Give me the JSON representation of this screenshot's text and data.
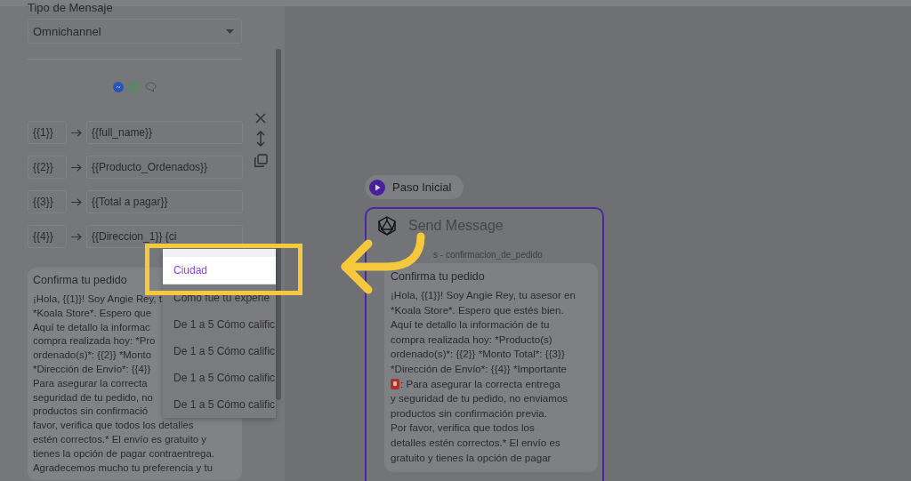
{
  "message_type": {
    "label": "Tipo de Mensaje",
    "value": "Omnichannel"
  },
  "variables": [
    {
      "key": "{{1}}",
      "value": "{{full_name}}"
    },
    {
      "key": "{{2}}",
      "value": "{{Producto_Ordenados}}"
    },
    {
      "key": "{{3}}",
      "value": "{{Total a pagar}}"
    },
    {
      "key": "{{4}}",
      "value": "{{Direccion_1}} {ci"
    }
  ],
  "preview": {
    "title": "Confirma tu pedido",
    "lines": [
      "¡Hola, {{1}}! Soy Angie Rey, t",
      "*Koala Store*. Espero que",
      "Aquí te detallo la informac",
      "compra realizada hoy: *Pro",
      "ordenado(s)*: {{2}} *Monto",
      "*Dirección de Envío*: {{4}}",
      "Para asegurar la correcta",
      "seguridad de tu pedido, no",
      "productos sin confirmació",
      "favor, verifica que todos los detalles",
      "estén correctos.* El envío es gratuito y",
      "tienes la opción de pagar contraentrega.",
      "Agradecemos mucho tu preferencia y tu"
    ]
  },
  "dropdown": {
    "items": [
      {
        "label": "Ciudad",
        "selected": true
      },
      {
        "label": "Cómo fue tu experie",
        "selected": false
      },
      {
        "label": "De 1 a 5 Cómo calific",
        "selected": false
      },
      {
        "label": "De 1 a 5 Cómo calific",
        "selected": false
      },
      {
        "label": "De 1 a 5 Cómo calific",
        "selected": false
      },
      {
        "label": "De 1 a 5 Cómo calific",
        "selected": false
      }
    ]
  },
  "start_node": {
    "label": "Paso Inicial"
  },
  "node": {
    "title": "Send Message",
    "subtitle": "s - confirmacion_de_pedido",
    "bubble": {
      "title": "Confirma tu pedido",
      "lines": [
        {
          "kind": "text",
          "text": "¡Hola, {{1}}! Soy Angie Rey, tu asesor en"
        },
        {
          "kind": "text",
          "text": "*Koala Store*. Espero que estés bien."
        },
        {
          "kind": "text",
          "text": "Aquí te detallo la información de tu"
        },
        {
          "kind": "text",
          "text": "compra realizada hoy: *Producto(s)"
        },
        {
          "kind": "text",
          "text": "ordenado(s)*: {{2}} *Monto Total*: {{3}}"
        },
        {
          "kind": "text",
          "text": "*Dirección de Envío*: {{4}} *Importante"
        },
        {
          "kind": "alert",
          "text": ": Para asegurar la correcta entrega"
        },
        {
          "kind": "text",
          "text": "y seguridad de tu pedido, no enviamos"
        },
        {
          "kind": "text",
          "text": "productos sin confirmación previa."
        },
        {
          "kind": "text",
          "text": "Por favor, verifica que todos los"
        },
        {
          "kind": "text",
          "text": "detalles estén correctos.* El envío es"
        },
        {
          "kind": "text",
          "text": "gratuito y tienes la opción de pagar"
        }
      ]
    }
  }
}
